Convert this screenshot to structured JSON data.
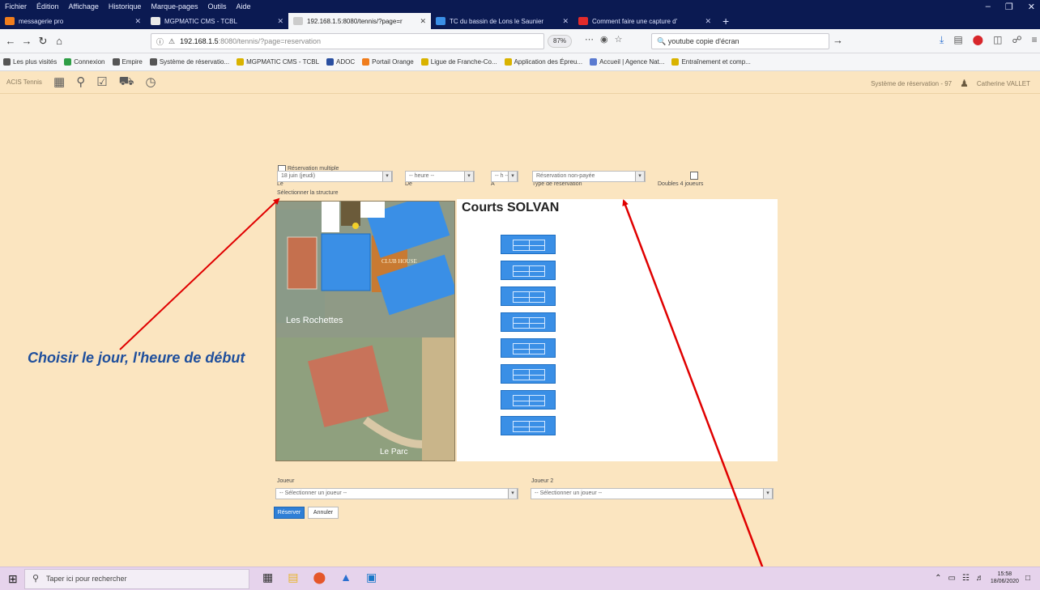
{
  "browser": {
    "menu": [
      "Fichier",
      "Édition",
      "Affichage",
      "Historique",
      "Marque-pages",
      "Outils",
      "Aide"
    ],
    "tabs": [
      {
        "label": "messagerie pro",
        "color": "#f07d1c"
      },
      {
        "label": "MGPMATIC CMS - TCBL",
        "color": "#e9e9e9"
      },
      {
        "label": "192.168.1.5:8080/tennis/?page=r",
        "color": "#cccccc"
      },
      {
        "label": "TC du bassin de Lons le Saunier",
        "color": "#3a8fe6"
      },
      {
        "label": "Comment faire une capture d'",
        "color": "#e32b2b"
      }
    ],
    "new_tab": "+",
    "url_host": "192.168.1.5",
    "url_path": ":8080/tennis/?page=reservation",
    "zoom": "87%",
    "search_value": "youtube copie d'écran",
    "bookmarks": [
      {
        "label": "Les plus visités",
        "color": "#555555"
      },
      {
        "label": "Connexion",
        "color": "#2e9e45"
      },
      {
        "label": "Empire",
        "color": "#555555"
      },
      {
        "label": "Système de réservatio...",
        "color": "#555555"
      },
      {
        "label": "MGPMATIC CMS - TCBL",
        "color": "#d9b300"
      },
      {
        "label": "ADOC",
        "color": "#2a4fa0"
      },
      {
        "label": "Portail Orange",
        "color": "#f07d1c"
      },
      {
        "label": "Ligue de Franche-Co...",
        "color": "#d9b300"
      },
      {
        "label": "Application des Épreu...",
        "color": "#d9b300"
      },
      {
        "label": "Accueil | Agence Nat...",
        "color": "#5a7ad0"
      },
      {
        "label": "Entraînement et comp...",
        "color": "#d9b300"
      }
    ]
  },
  "app": {
    "brand": "ACIS Tennis",
    "right_link": "Système de réservation - 97",
    "user": "Catherine VALLET"
  },
  "form": {
    "multiple_label": "Réservation multiple",
    "le_label": "Le",
    "le_value": "18 juin (jeudi)",
    "de_label": "De",
    "de_value": "-- heure --",
    "a_label": "À",
    "a_value": "-- h --",
    "type_label": "Type de réservation",
    "type_value": "Réservation non-payée",
    "double_label": "Doubles 4 joueurs",
    "select_structure": "Sélectionner la structure"
  },
  "map": {
    "club_house": "CLUB HOUSE",
    "les_rochettes": "Les Rochettes",
    "le_parc": "Le Parc"
  },
  "courts": {
    "title": "Courts SOLVAN",
    "count": 8
  },
  "players": {
    "j1_label": "Joueur",
    "j1_value": "-- Sélectionner un joueur --",
    "j2_label": "Joueur 2",
    "j2_value": "-- Sélectionner un joueur --",
    "reserve_btn": "Réserver",
    "cancel_btn": "Annuler"
  },
  "annotation": "Choisir le jour, l'heure de début",
  "taskbar": {
    "search_placeholder": "Taper ici pour rechercher",
    "time": "15:58",
    "date": "18/06/2020"
  },
  "colors": {
    "page_bg": "#fbe5c0",
    "court_blue": "#3a8fe6",
    "annotation_text": "#1f4f9c",
    "arrow_red": "#e00000"
  }
}
